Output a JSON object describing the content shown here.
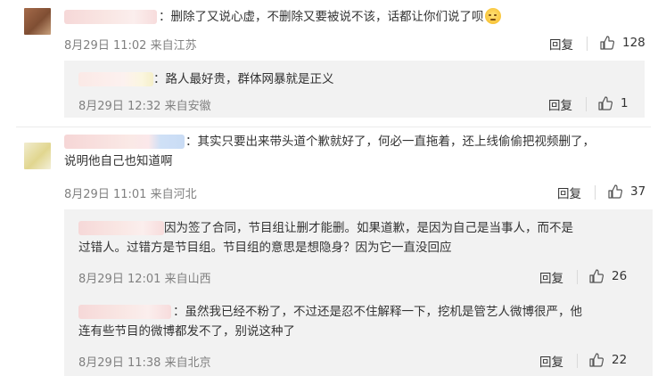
{
  "reply_label": "回复",
  "comments": [
    {
      "text": "：删除了又说心虚，不删除又要被说不该，话都让你们说了呗",
      "emoji": "smile-emoji",
      "time": "8月29日 11:02",
      "source": "来自江苏",
      "likes": "128",
      "replies": [
        {
          "text": "：路人最好贵，群体网暴就是正义",
          "time": "8月29日 12:32",
          "source": "来自安徽",
          "likes": "1"
        }
      ]
    },
    {
      "text_line1": "：其实只要出来带头道个歉就好了，何必一直拖着，还上线偷偷把视频删了，",
      "text_line2": "说明他自己也知道啊",
      "time": "8月29日 11:01",
      "source": "来自河北",
      "likes": "37",
      "replies": [
        {
          "text_line1": "因为签了合同，节目组让删才能删。如果道歉，是因为自己是当事人，而不是",
          "text_line2": "过错人。过错方是节目组。节目组的意思是想隐身？因为它一直没回应",
          "time": "8月29日 12:01",
          "source": "来自山西",
          "likes": "26"
        },
        {
          "text_line1": "：虽然我已经不粉了，不过还是忍不住解释一下，挖机是管艺人微博很严，他",
          "text_line2": "连有些节目的微博都发不了，别说这种了",
          "time": "8月29日 11:38",
          "source": "来自北京",
          "likes": "22"
        }
      ]
    }
  ]
}
